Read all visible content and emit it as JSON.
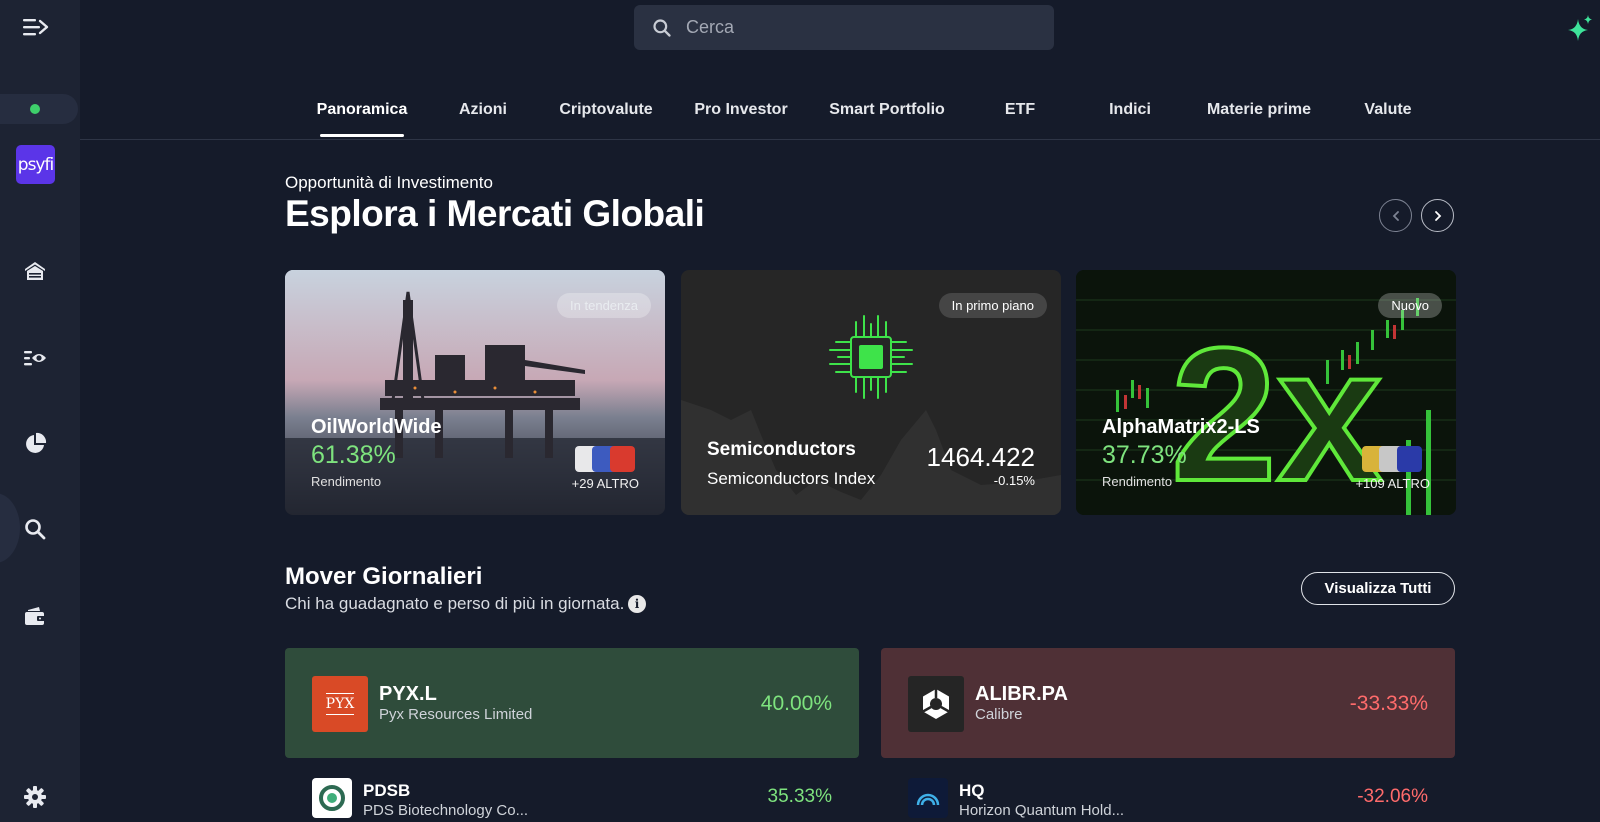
{
  "brand": {
    "logo_text": "psyfi"
  },
  "search": {
    "placeholder": "Cerca"
  },
  "sidebar": {
    "items": [
      {
        "icon": "home-icon"
      },
      {
        "icon": "watchlist-icon"
      },
      {
        "icon": "portfolio-pie-icon"
      },
      {
        "icon": "search-icon"
      },
      {
        "icon": "wallet-icon"
      },
      {
        "icon": "settings-icon"
      }
    ]
  },
  "tabs": [
    "Panoramica",
    "Azioni",
    "Criptovalute",
    "Pro Investor",
    "Smart Portfolio",
    "ETF",
    "Indici",
    "Materie prime",
    "Valute"
  ],
  "active_tab": "Panoramica",
  "hero": {
    "eyebrow": "Opportunità di Investimento",
    "title": "Esplora i Mercati Globali"
  },
  "cards": [
    {
      "badge": "In tendenza",
      "title": "OilWorldWide",
      "pct": "61.38%",
      "sub": "Rendimento",
      "more": "+29 ALTRO"
    },
    {
      "badge": "In primo piano",
      "title": "Semiconductors",
      "sub": "Semiconductors Index",
      "value": "1464.422",
      "change": "-0.15%"
    },
    {
      "badge": "Nuovo",
      "title": "AlphaMatrix2-LS",
      "pct": "37.73%",
      "sub": "Rendimento",
      "more": "+109 ALTRO",
      "bg_text": "2x"
    }
  ],
  "movers": {
    "title": "Mover Giornalieri",
    "subtitle": "Chi ha guadagnato e perso di più in giornata.",
    "view_all": "Visualizza Tutti",
    "gainers": [
      {
        "symbol": "PYX.L",
        "name": "Pyx Resources Limited",
        "pct": "40.00%",
        "logo_text": "PYX"
      },
      {
        "symbol": "PDSB",
        "name": "PDS Biotechnology Co...",
        "pct": "35.33%"
      }
    ],
    "losers": [
      {
        "symbol": "ALIBR.PA",
        "name": "Calibre",
        "pct": "-33.33%"
      },
      {
        "symbol": "HQ",
        "name": "Horizon Quantum Hold...",
        "pct": "-32.06%"
      }
    ]
  },
  "colors": {
    "positive": "#7ee37e",
    "negative": "#ff6b6b",
    "brand": "#5b35e8",
    "status": "#3ecf6b"
  }
}
